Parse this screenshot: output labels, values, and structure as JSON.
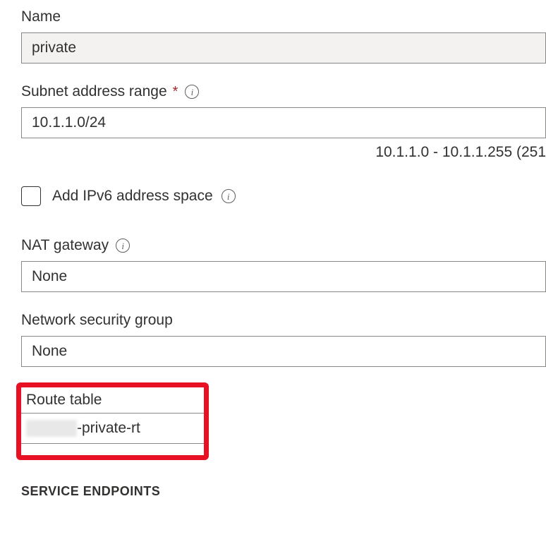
{
  "name": {
    "label": "Name",
    "value": "private"
  },
  "subnet_range": {
    "label": "Subnet address range",
    "required_mark": "*",
    "value": "10.1.1.0/24",
    "help_text": "10.1.1.0 - 10.1.1.255 (251"
  },
  "ipv6": {
    "checkbox_label": "Add IPv6 address space"
  },
  "nat_gateway": {
    "label": "NAT gateway",
    "value": "None"
  },
  "nsg": {
    "label": "Network security group",
    "value": "None"
  },
  "route_table": {
    "label": "Route table",
    "value_suffix": "-private-rt"
  },
  "section": {
    "service_endpoints": "SERVICE ENDPOINTS"
  }
}
